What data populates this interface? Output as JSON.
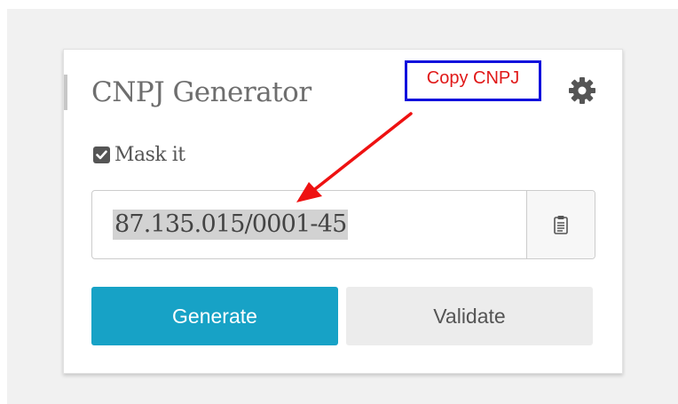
{
  "widget": {
    "title": "CNPJ Generator",
    "mask_option": {
      "label": "Mask it",
      "checked": true
    },
    "cnpj_value": "87.135.015/0001-45",
    "buttons": {
      "generate_label": "Generate",
      "validate_label": "Validate"
    },
    "icons": {
      "settings": "gear-icon",
      "copy": "clipboard-icon",
      "checkbox": "check-icon"
    }
  },
  "annotation": {
    "label": "Copy CNPJ",
    "text_color": "#e01818",
    "box_color": "#1111dd",
    "arrow_color": "#ee1111"
  },
  "colors": {
    "primary": "#17a2c6",
    "secondary": "#ececec",
    "page_background": "#f1f1f1"
  }
}
